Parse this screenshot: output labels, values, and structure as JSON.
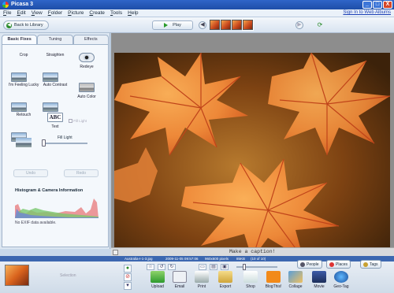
{
  "window": {
    "title": "Picasa 3",
    "minimize": "_",
    "maximize": "□",
    "close": "X"
  },
  "menu": [
    "File",
    "Edit",
    "View",
    "Folder",
    "Picture",
    "Create",
    "Tools",
    "Help"
  ],
  "signin": "Sign In to Web Albums",
  "toolbar": {
    "back_label": "Back to Library",
    "play_label": "Play",
    "prev": "◀",
    "next": "▶",
    "rotate": "⟳"
  },
  "tabs": [
    "Basic Fixes",
    "Tuning",
    "Effects"
  ],
  "tools": [
    "Crop",
    "Straighten",
    "Redeye",
    "I'm Feeling Lucky",
    "Auto Contrast",
    "Auto Color",
    "Retouch",
    "Text"
  ],
  "text_tool_glyph": "ABC",
  "fill_light": {
    "label": "Fill Light",
    "value": 0
  },
  "redeye_option": "Fill Light",
  "undo_label": "Undo",
  "redo_label": "Redo",
  "histogram_title": "Histogram & Camera Information",
  "exif_note": "No EXIF data available.",
  "caption_placeholder": "Make a caption!",
  "status": {
    "filename": "Australia-I-1-3.jpg",
    "date": "2009-11-05 09:57:06",
    "dims": "960x600 pixels",
    "size": "85KB",
    "position": "(10 of 10)"
  },
  "tray": {
    "selection_label": "Selection",
    "people": "People",
    "places": "Places",
    "tags": "Tags",
    "actions": [
      "Upload",
      "Email",
      "Print",
      "Export",
      "Shop",
      "BlogThis!",
      "Collage",
      "Movie",
      "Geo-Tag"
    ]
  },
  "colors": {
    "titlebar": "#1e4ea8",
    "statusbar": "#3c67b0",
    "panel": "#dde7f2",
    "photo_bg": "#8d8d8d"
  }
}
